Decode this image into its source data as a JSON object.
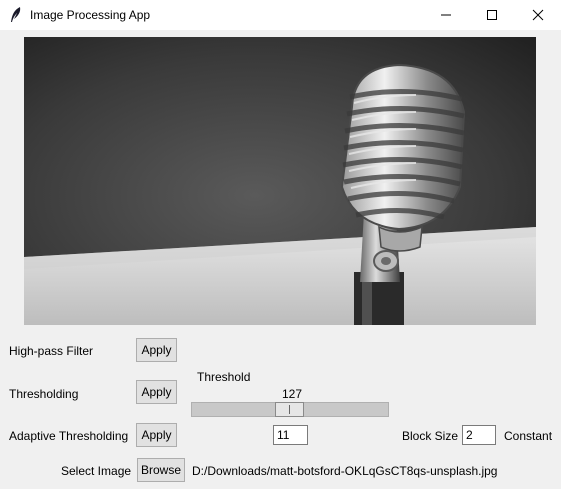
{
  "window": {
    "title": "Image Processing App",
    "icon": "feather-icon"
  },
  "image": {
    "description_icon": "microphone-photo"
  },
  "high_pass": {
    "label": "High-pass Filter",
    "apply_label": "Apply"
  },
  "thresholding": {
    "label": "Thresholding",
    "apply_label": "Apply",
    "slider_label": "Threshold",
    "slider_value": 127,
    "slider_value_text": "127",
    "slider_min": 0,
    "slider_max": 255
  },
  "adaptive": {
    "label": "Adaptive Thresholding",
    "apply_label": "Apply",
    "value1": "11",
    "block_size_label": "Block Size",
    "block_size_value": "2",
    "constant_label": "Constant"
  },
  "select_image": {
    "label": "Select Image",
    "browse_label": "Browse",
    "path": "D:/Downloads/matt-botsford-OKLqGsCT8qs-unsplash.jpg"
  }
}
